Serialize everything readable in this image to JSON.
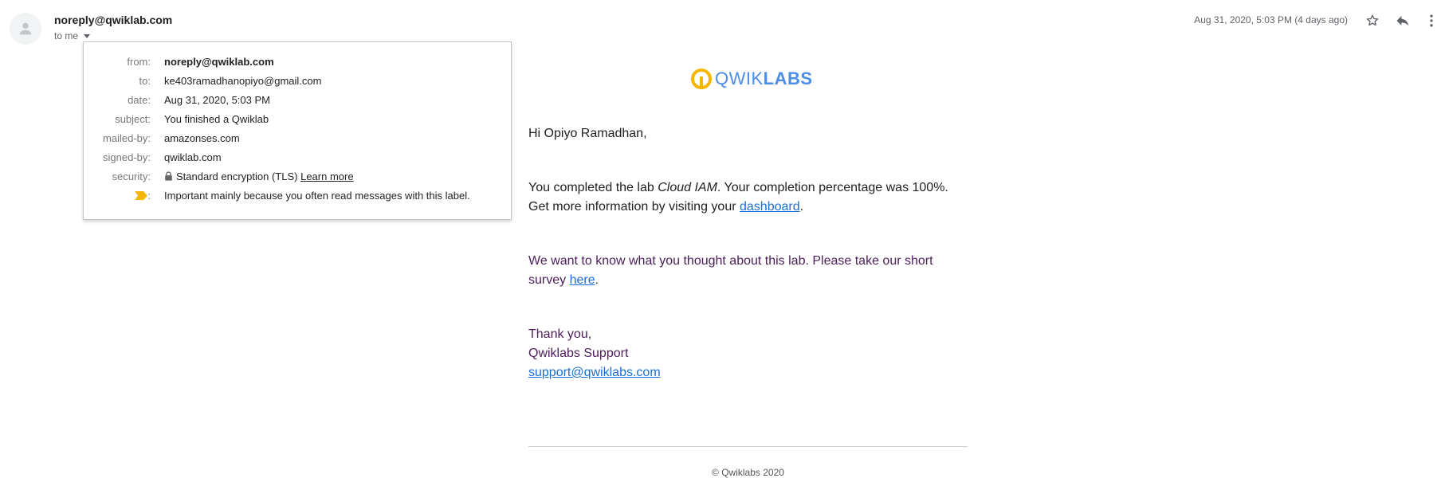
{
  "header": {
    "sender": "noreply@qwiklab.com",
    "to_label": "to me",
    "date": "Aug 31, 2020, 5:03 PM (4 days ago)"
  },
  "details": {
    "rows": [
      {
        "label": "from:",
        "value": "noreply@qwiklab.com"
      },
      {
        "label": "to:",
        "value": "ke403ramadhanopiyo@gmail.com"
      },
      {
        "label": "date:",
        "value": "Aug 31, 2020, 5:03 PM"
      },
      {
        "label": "subject:",
        "value": "You finished a Qwiklab"
      },
      {
        "label": "mailed-by:",
        "value": "amazonses.com"
      },
      {
        "label": "signed-by:",
        "value": "qwiklab.com"
      },
      {
        "label": "security:",
        "value": "Standard encryption (TLS)",
        "link": "Learn more"
      },
      {
        "label": ":",
        "value": "Important mainly because you often read messages with this label."
      }
    ]
  },
  "body": {
    "logo_light": "QWIK",
    "logo_bold": "LABS",
    "greeting": "Hi Opiyo Ramadhan,",
    "p1_a": "You completed the lab ",
    "p1_lab": "Cloud IAM",
    "p1_b": ". Your completion percentage was 100%.",
    "p2_a": "Get more information by visiting your ",
    "p2_link": "dashboard",
    "p2_b": ".",
    "p3_line1": "We want to know what you thought about this lab. Please take our short",
    "p3_a": "survey ",
    "p3_link": "here",
    "p3_b": ".",
    "thanks": "Thank you,",
    "team": "Qwiklabs Support",
    "email": "support@qwiklabs.com",
    "footer": "© Qwiklabs 2020"
  },
  "colors": {
    "accent": "#1a6fd1",
    "logo_blue": "#4a8ee8",
    "logo_yellow": "#f6b600",
    "important_marker": "#f6b600"
  },
  "icons": [
    "person-icon",
    "caret-down-icon",
    "star-icon",
    "reply-icon",
    "more-vert-icon",
    "lock-icon",
    "importance-marker-icon"
  ]
}
